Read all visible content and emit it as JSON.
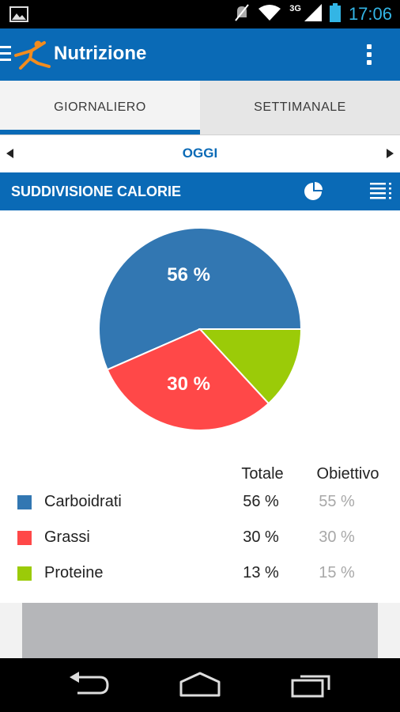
{
  "status_bar": {
    "time": "17:06",
    "network": "3G",
    "icons": [
      "image-notification-icon",
      "mute-icon",
      "wifi-icon",
      "signal-icon",
      "battery-icon"
    ]
  },
  "app_bar": {
    "title": "Nutrizione",
    "icons": [
      "menu-icon",
      "app-logo-icon",
      "overflow-menu-icon"
    ]
  },
  "tabs": [
    {
      "label": "GIORNALIERO",
      "selected": true
    },
    {
      "label": "SETTIMANALE",
      "selected": false
    }
  ],
  "date_nav": {
    "label": "OGGI"
  },
  "section": {
    "title": "SUDDIVISIONE CALORIE",
    "icons": [
      "pie-chart-view-icon",
      "list-view-icon"
    ]
  },
  "legend": {
    "total_header": "Totale",
    "goal_header": "Obiettivo",
    "rows": [
      {
        "name": "Carboidrati",
        "total": "56 %",
        "goal": "55 %",
        "color": "#3277b2"
      },
      {
        "name": "Grassi",
        "total": "30 %",
        "goal": "30 %",
        "color": "#ff4848"
      },
      {
        "name": "Proteine",
        "total": "13 %",
        "goal": "15 %",
        "color": "#9bcb08"
      }
    ]
  },
  "chart_data": {
    "type": "pie",
    "categories": [
      "Carboidrati",
      "Grassi",
      "Proteine"
    ],
    "values": [
      56,
      30,
      13
    ],
    "colors": [
      "#3277b2",
      "#ff4848",
      "#9bcb08"
    ],
    "slice_labels": [
      "56 %",
      "30 %",
      ""
    ]
  },
  "colors": {
    "primary": "#0a6ab6",
    "status_accent": "#33b5e5"
  },
  "nav_bar": {
    "icons": [
      "back-icon",
      "home-icon",
      "recent-apps-icon"
    ]
  }
}
